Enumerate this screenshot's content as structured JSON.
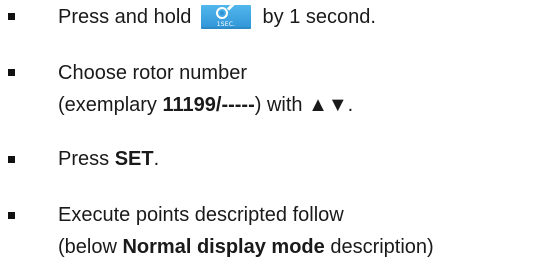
{
  "instructions": {
    "step1": {
      "before": "Press and hold",
      "after": "by 1 second.",
      "icon_name": "settings-1sec-button-icon",
      "icon_caption": "1SEC."
    },
    "step2": {
      "line1": "Choose rotor number",
      "line2_prefix": "(exemplary ",
      "line2_bold": "11199/-----",
      "line2_suffix": ") with ▲▼."
    },
    "step3": {
      "prefix": "Press ",
      "bold": "SET",
      "suffix": "."
    },
    "step4": {
      "line1": "Execute points descripted follow",
      "line2_prefix": "(below ",
      "line2_bold": "Normal display mode",
      "line2_suffix": " description)"
    }
  },
  "colors": {
    "text": "#1a1a1a",
    "icon_blue": "#2f95d7"
  }
}
